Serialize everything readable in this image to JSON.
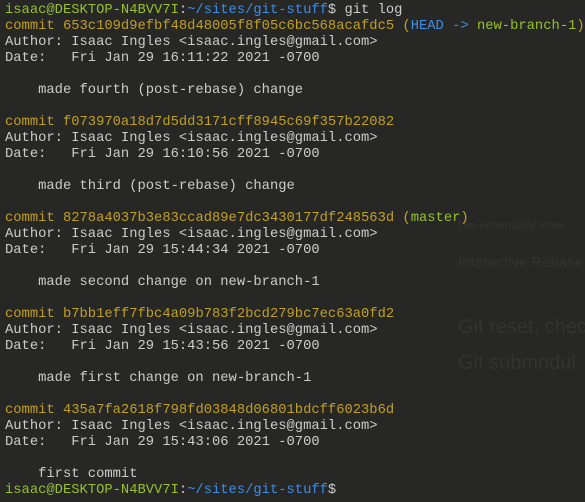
{
  "prompt": {
    "user_host": "isaac@DESKTOP-N4BVV7I",
    "sep": ":",
    "path": "~/sites/git-stuff",
    "symbol": "$"
  },
  "command": " git log",
  "commits": [
    {
      "hash": "653c109d9efbf48d48005f8f05c6bc568acafdc5",
      "refs": {
        "head": "HEAD ->",
        "branch": "new-branch-1"
      },
      "author": "Isaac Ingles <isaac.ingles@gmail.com>",
      "date": "Fri Jan 29 16:11:22 2021 -0700",
      "message": "made fourth (post-rebase) change"
    },
    {
      "hash": "f073970a18d7d5dd3171cff8945c69f357b22082",
      "author": "Isaac Ingles <isaac.ingles@gmail.com>",
      "date": "Fri Jan 29 16:10:56 2021 -0700",
      "message": "made third (post-rebase) change"
    },
    {
      "hash": "8278a4037b3e83ccad89e7dc3430177df248563d",
      "refs": {
        "branch": "master"
      },
      "author": "Isaac Ingles <isaac.ingles@gmail.com>",
      "date": "Fri Jan 29 15:44:34 2021 -0700",
      "message": "made second change on new-branch-1"
    },
    {
      "hash": "b7bb1eff7fbc4a09b783f2bcd279bc7ec63a0fd2",
      "author": "Isaac Ingles <isaac.ingles@gmail.com>",
      "date": "Fri Jan 29 15:43:56 2021 -0700",
      "message": "made first change on new-branch-1"
    },
    {
      "hash": "435a7fa2618f798fd03848d06801bdcff6023b6d",
      "author": "Isaac Ingles <isaac.ingles@gmail.com>",
      "date": "Fri Jan 29 15:43:06 2021 -0700",
      "message": "first commit"
    }
  ],
  "labels": {
    "commit": "commit ",
    "author": "Author: ",
    "date": "Date:   ",
    "indent": "    "
  },
  "ghost": {
    "g1": "Git reset, chec",
    "g2": "Git submodul",
    "g3": "Interactive Rebase",
    "g4": "I've essentially inser"
  }
}
